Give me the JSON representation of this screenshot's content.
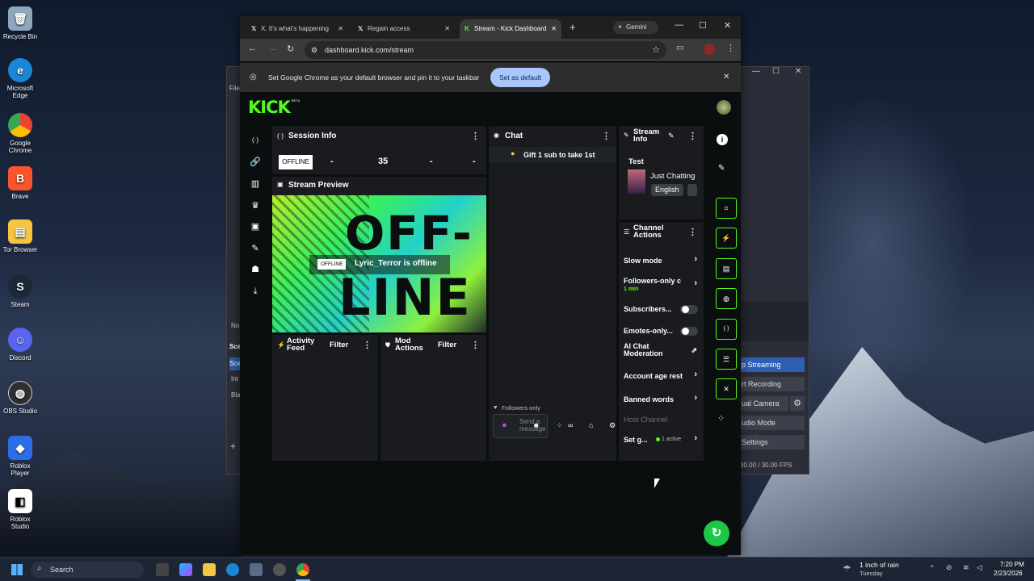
{
  "desktop": {
    "icons": [
      "Recycle Bin",
      "Microsoft Edge",
      "Google Chrome",
      "Brave",
      "Tor Browser",
      "Steam",
      "Discord",
      "OBS Studio",
      "Roblox Player",
      "Roblox Studio"
    ]
  },
  "obs": {
    "buttons": [
      "p Streaming",
      "rt Recording",
      "ual Camera",
      "udio Mode",
      "Settings"
    ],
    "fps": "30.00 / 30.00 FPS",
    "left_labels": [
      "File",
      "No",
      "Sce",
      "Sce",
      "Int",
      "Bla",
      "+"
    ]
  },
  "browser": {
    "tabs": [
      {
        "title": "X. It's what's happening"
      },
      {
        "title": "Regain access"
      },
      {
        "title": "Stream - Kick Dashboard"
      }
    ],
    "gemini": "Gemini",
    "url": "dashboard.kick.com/stream",
    "infobar_text": "Set Google Chrome as your default browser and pin it to your taskbar",
    "set_default": "Set as default"
  },
  "kick": {
    "logo": "KICK",
    "beta": "BETA",
    "session": {
      "title": "Session Info",
      "status": "OFFLINE",
      "stats": [
        "-",
        "35",
        "-",
        "-"
      ]
    },
    "preview": {
      "title": "Stream Preview",
      "badge": "OFFLINE",
      "message": "Lyric_Terror is offline",
      "art_text": [
        "OFF-",
        "LINE"
      ]
    },
    "activity": {
      "title": "Activity Feed",
      "filter": "Filter"
    },
    "mod": {
      "title": "Mod Actions",
      "filter": "Filter"
    },
    "chat": {
      "title": "Chat",
      "gift": "Gift 1 sub to take 1st",
      "followers_only": "Followers only",
      "placeholder": "Send a message"
    },
    "stream_info": {
      "title": "Stream Info",
      "stream_title": "Test",
      "category": "Just Chatting",
      "language": "English"
    },
    "channel_actions": {
      "title": "Channel Actions",
      "slow": "Slow mode",
      "followers": "Followers-only c",
      "followers_sub": "1 min",
      "subscribers": "Subscribers...",
      "emotes": "Emotes-only...",
      "ai": "AI Chat Moderation",
      "age": "Account age rest",
      "banned": "Banned words",
      "host": "Host Channel",
      "set_goal": "Set g...",
      "active": "1 active"
    }
  },
  "taskbar": {
    "search": "Search",
    "weather": "1 inch of rain",
    "weather_sub": "Tuesday",
    "time": "7:20 PM",
    "date": "2/23/2026"
  },
  "colors": {
    "kick_green": "#53fc18",
    "panel": "#191b1f",
    "bg": "#0b0e0f"
  }
}
